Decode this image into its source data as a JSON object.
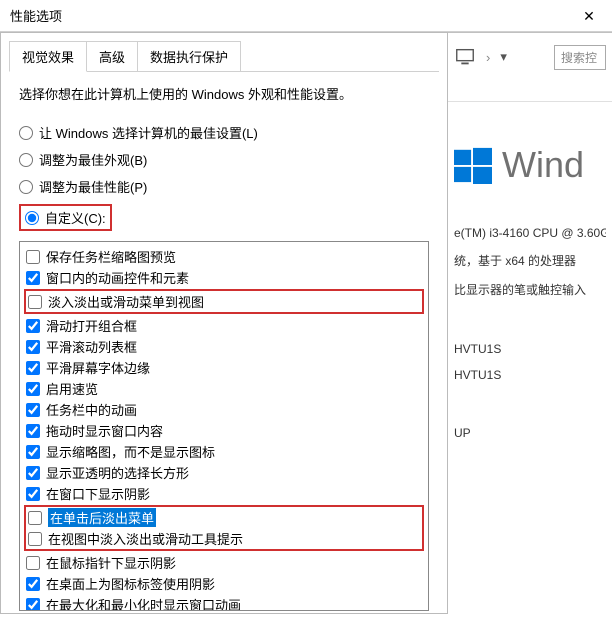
{
  "titlebar": {
    "title": "性能选项",
    "close": "✕"
  },
  "tabs": [
    {
      "label": "视觉效果",
      "active": true
    },
    {
      "label": "高级",
      "active": false
    },
    {
      "label": "数据执行保护",
      "active": false
    }
  ],
  "description": "选择你想在此计算机上使用的 Windows 外观和性能设置。",
  "radios": {
    "best_auto": "让 Windows 选择计算机的最佳设置(L)",
    "best_appearance": "调整为最佳外观(B)",
    "best_perf": "调整为最佳性能(P)",
    "custom": "自定义(C):"
  },
  "checks": [
    {
      "label": "保存任务栏缩略图预览",
      "checked": false,
      "red": false
    },
    {
      "label": "窗口内的动画控件和元素",
      "checked": true,
      "red": false
    },
    {
      "label": "淡入淡出或滑动菜单到视图",
      "checked": false,
      "red": true
    },
    {
      "label": "滑动打开组合框",
      "checked": true,
      "red": false
    },
    {
      "label": "平滑滚动列表框",
      "checked": true,
      "red": false
    },
    {
      "label": "平滑屏幕字体边缘",
      "checked": true,
      "red": false
    },
    {
      "label": "启用速览",
      "checked": true,
      "red": false
    },
    {
      "label": "任务栏中的动画",
      "checked": true,
      "red": false
    },
    {
      "label": "拖动时显示窗口内容",
      "checked": true,
      "red": false
    },
    {
      "label": "显示缩略图，而不是显示图标",
      "checked": true,
      "red": false
    },
    {
      "label": "显示亚透明的选择长方形",
      "checked": true,
      "red": false
    },
    {
      "label": "在窗口下显示阴影",
      "checked": true,
      "red": false
    },
    {
      "label": "在单击后淡出菜单",
      "checked": false,
      "red": true,
      "selected": true
    },
    {
      "label": "在视图中淡入淡出或滑动工具提示",
      "checked": false,
      "red": true
    },
    {
      "label": "在鼠标指针下显示阴影",
      "checked": false,
      "red": false
    },
    {
      "label": "在桌面上为图标标签使用阴影",
      "checked": true,
      "red": false
    },
    {
      "label": "在最大化和最小化时显示窗口动画",
      "checked": true,
      "red": false
    }
  ],
  "bg": {
    "search_placeholder": "搜索控",
    "logo_text": "Wind",
    "cpu": "e(TM) i3-4160 CPU @ 3.60G",
    "arch": "统，基于 x64 的处理器",
    "pen": "比显示器的笔或触控输入",
    "name1": "HVTU1S",
    "name2": "HVTU1S",
    "wg": "UP"
  }
}
